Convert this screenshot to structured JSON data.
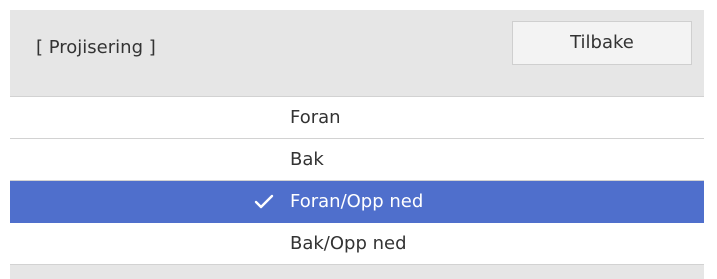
{
  "header": {
    "title": "[ Projisering ]",
    "back_label": "Tilbake"
  },
  "options": [
    {
      "label": "Foran",
      "selected": false
    },
    {
      "label": "Bak",
      "selected": false
    },
    {
      "label": "Foran/Opp ned",
      "selected": true
    },
    {
      "label": "Bak/Opp ned",
      "selected": false
    }
  ],
  "colors": {
    "selection": "#4f6fcc",
    "header_bg": "#e6e6e6"
  },
  "icons": {
    "selected_marker": "checkmark-icon"
  }
}
